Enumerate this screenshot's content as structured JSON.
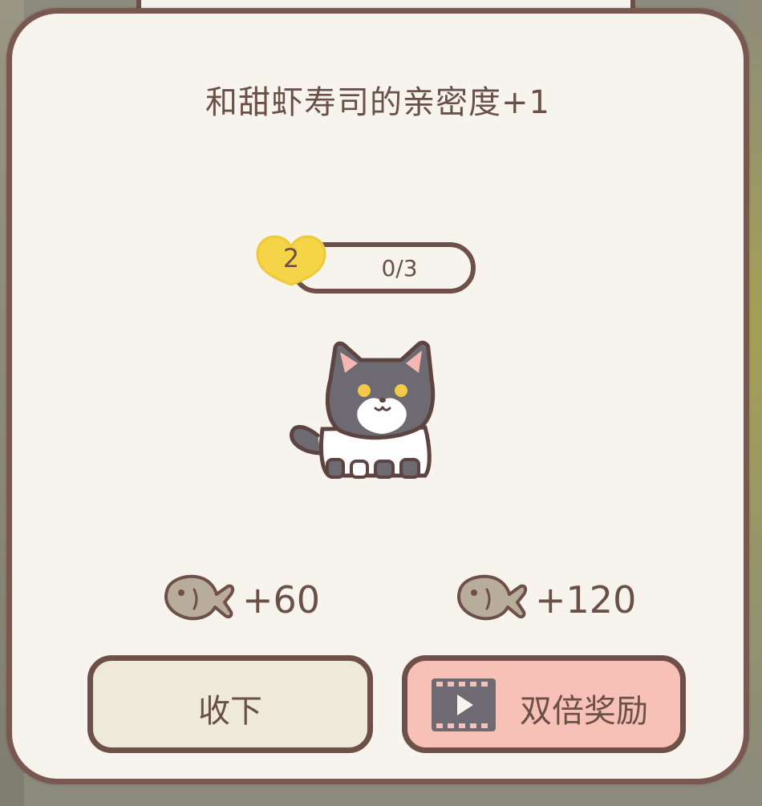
{
  "dialog": {
    "title": "和甜虾寿司的亲密度+1"
  },
  "affinity": {
    "level": "2",
    "progress_text": "0/3",
    "progress_fraction": 0
  },
  "rewards": {
    "normal_amount": "+60",
    "double_amount": "+120"
  },
  "buttons": {
    "collect_label": "收下",
    "double_label": "双倍奖励"
  },
  "icons": {
    "heart": "heart-icon",
    "fish": "fish-icon",
    "video": "video-play-icon",
    "cat": "cat-character"
  },
  "colors": {
    "border": "#7a5850",
    "panel": "#f7f4ee",
    "heart": "#f5d547",
    "collect_button": "#efe9dc",
    "double_button": "#f8c1b8",
    "text": "#6a5047"
  }
}
